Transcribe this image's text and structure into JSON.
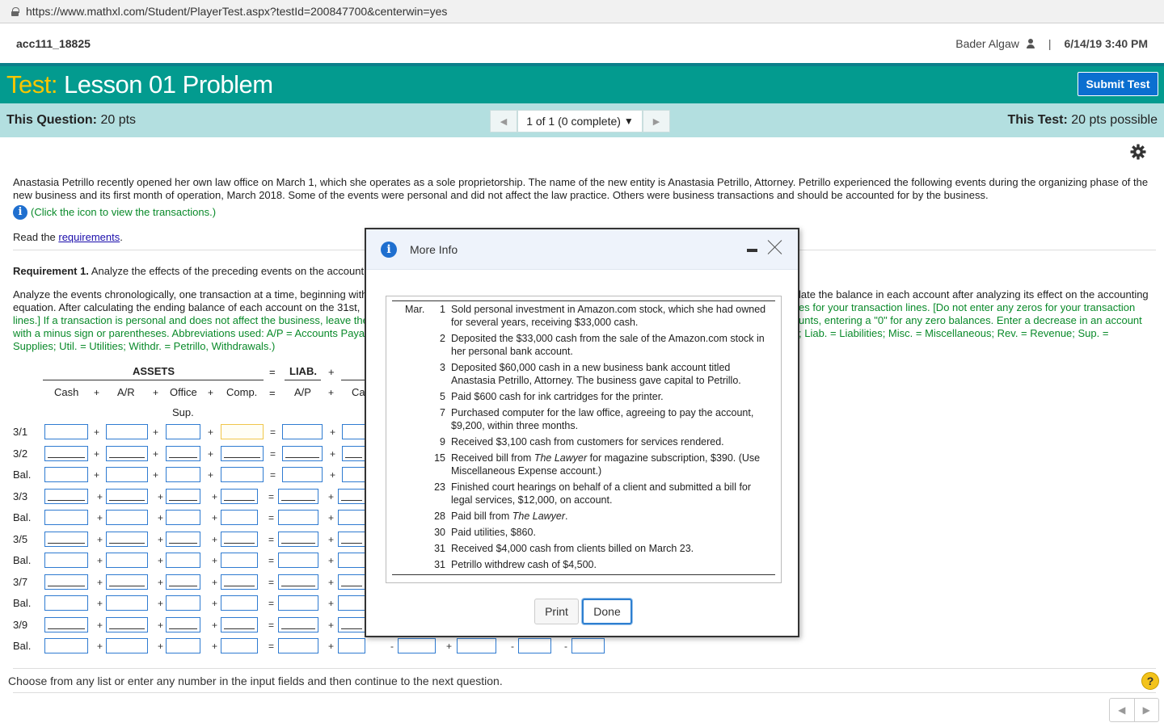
{
  "browser": {
    "url": "https://www.mathxl.com/Student/PlayerTest.aspx?testId=200847700&centerwin=yes"
  },
  "header": {
    "course": "acc111_18825",
    "user": "Bader Algaw",
    "separator": "|",
    "datetime": "6/14/19 3:40 PM"
  },
  "titlebar": {
    "label": "Test:",
    "name": "Lesson 01 Problem",
    "submit": "Submit Test"
  },
  "qbar": {
    "this_question_label": "This Question:",
    "this_question_pts": "20 pts",
    "nav": "1 of 1 (0 complete)",
    "this_test_label": "This Test:",
    "this_test_pts": "20 pts possible"
  },
  "problem": {
    "intro": "Anastasia Petrillo recently opened her own law office on March 1, which she operates as a sole proprietorship. The name of the new entity is Anastasia Petrillo, Attorney. Petrillo experienced the following events during the organizing phase of the new business and its first month of operation, March 2018. Some of the events were personal and did not affect the law practice. Others were business transactions and should be accounted for by the business.",
    "info_link": "(Click the icon to view the transactions.)",
    "read_prefix": "Read the ",
    "read_link": "requirements",
    "read_suffix": ".",
    "req1_bold": "Requirement 1.",
    "req1_text": " Analyze the effects of the preceding events on the account",
    "instr_left": [
      "Analyze the events chronologically, one transaction at a time, beginning with",
      "equation. After calculating the ending balance of each account on the 31st,",
      "lines.] If a transaction is personal and does not affect the business, leave the",
      "with a minus sign or parentheses. Abbreviations used: A/P = Accounts Paya",
      "Supplies; Util. = Utilities; Withdr. = Petrillo, Withdrawals.)"
    ],
    "instr_right": [
      "late the balance in each account after analyzing its effect on the accounting",
      "es for your transaction lines. [Do not enter any zeros for your transaction",
      "unts, entering a \"0\" for any zero balances. Enter a decrease in an account",
      "; Liab. = Liabilities; Misc. = Miscellaneous; Rev. = Revenue; Sup. ="
    ]
  },
  "table": {
    "assets": "ASSETS",
    "eq": "=",
    "liab": "LIAB.",
    "plus": "+",
    "minus": "-",
    "cols": [
      "Cash",
      "A/R",
      "Office",
      "Comp.",
      "A/P",
      "Ca"
    ],
    "sup": "Sup.",
    "rows": [
      "3/1",
      "3/2",
      "Bal.",
      "3/3",
      "Bal.",
      "3/5",
      "Bal.",
      "3/7",
      "Bal.",
      "3/9",
      "Bal."
    ]
  },
  "footer": {
    "hint": "Choose from any list or enter any number in the input fields and then continue to the next question.",
    "help": "?"
  },
  "modal": {
    "title": "More Info",
    "month": "Mar.",
    "transactions": [
      {
        "day": "1",
        "text": "Sold personal investment in Amazon.com stock, which she had owned for several years, receiving $33,000 cash."
      },
      {
        "day": "2",
        "text": "Deposited the $33,000 cash from the sale of the Amazon.com stock in her personal bank account."
      },
      {
        "day": "3",
        "text": "Deposited $60,000 cash in a new business bank account titled Anastasia Petrillo, Attorney. The business gave capital to Petrillo."
      },
      {
        "day": "5",
        "text": "Paid $600 cash for ink cartridges for the printer."
      },
      {
        "day": "7",
        "text": "Purchased computer for the law office, agreeing to pay the account, $9,200, within three months."
      },
      {
        "day": "9",
        "text": "Received $3,100 cash from customers for services rendered."
      },
      {
        "day": "15",
        "text_pre": "Received bill from ",
        "text_it": "The Lawyer",
        "text_post": " for magazine subscription, $390. (Use Miscellaneous Expense account.)"
      },
      {
        "day": "23",
        "text": "Finished court hearings on behalf of a client and submitted a bill for legal services, $12,000, on account."
      },
      {
        "day": "28",
        "text_pre": "Paid bill from ",
        "text_it": "The Lawyer",
        "text_post": "."
      },
      {
        "day": "30",
        "text": "Paid utilities, $860."
      },
      {
        "day": "31",
        "text": "Received $4,000 cash from clients billed on March 23."
      },
      {
        "day": "31",
        "text": "Petrillo withdrew cash of $4,500."
      }
    ],
    "print": "Print",
    "done": "Done"
  }
}
